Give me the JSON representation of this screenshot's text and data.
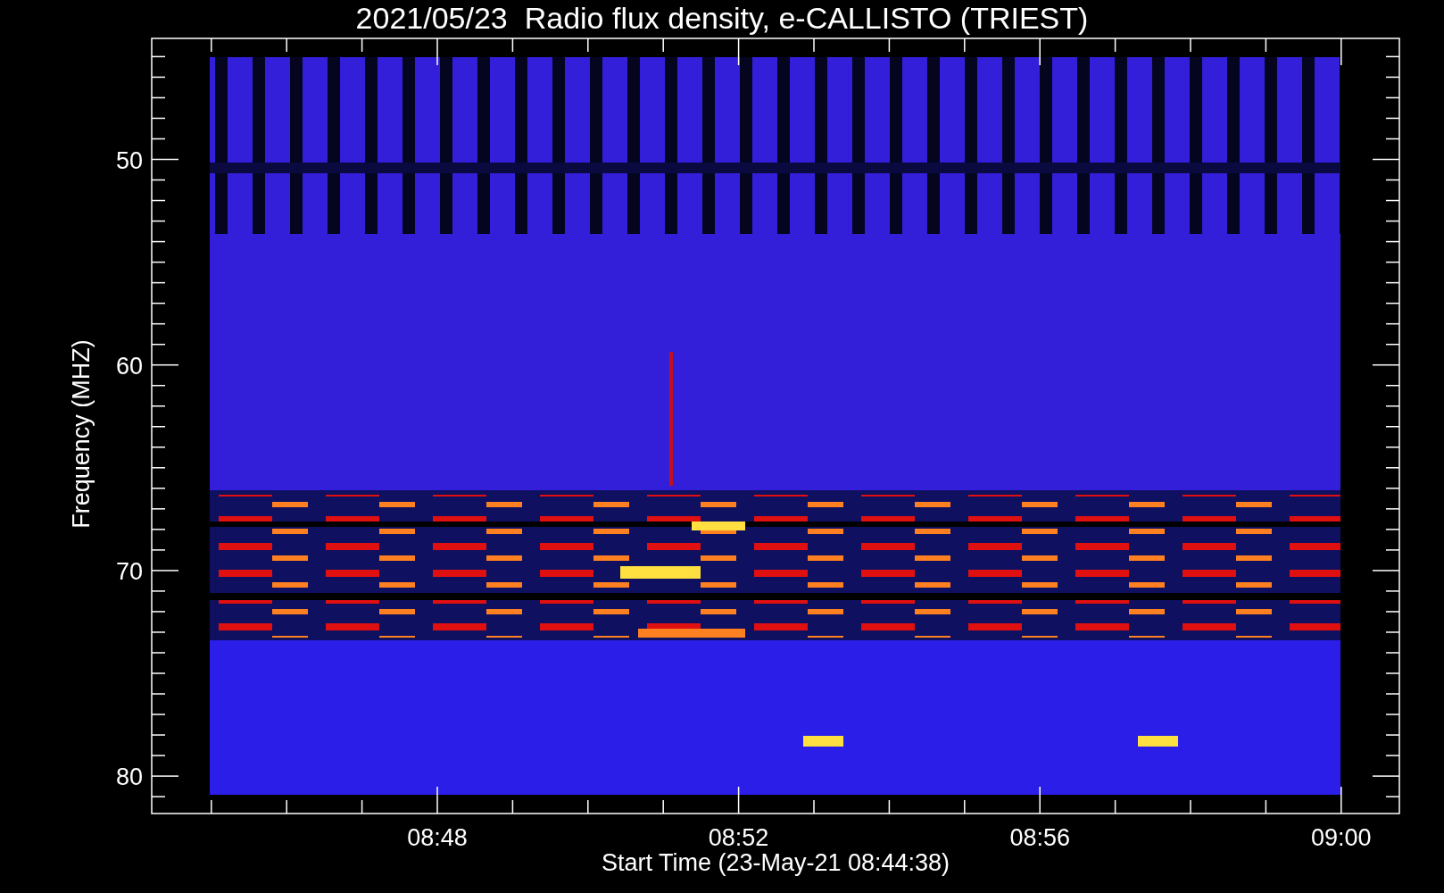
{
  "title": "2021/05/23  Radio flux density, e-CALLISTO (TRIEST)",
  "y_axis": {
    "label": "Frequency (MHZ)",
    "tick_labels": [
      "50",
      "60",
      "70",
      "80"
    ]
  },
  "x_axis": {
    "label": "Start Time (23-May-21 08:44:38)",
    "tick_labels": [
      "08:48",
      "08:52",
      "08:56",
      "09:00"
    ]
  }
}
